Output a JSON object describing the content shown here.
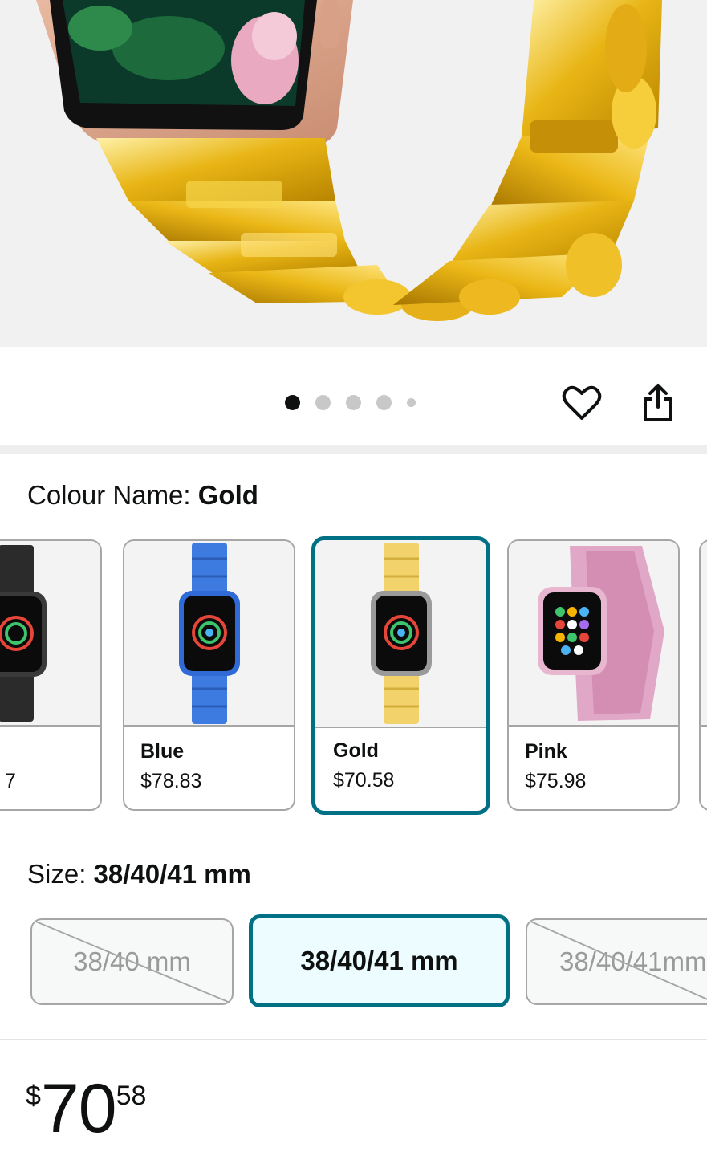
{
  "gallery": {
    "image_alt": "Gold stainless steel watch band on rose gold watch",
    "dot_count": 5,
    "active_index": 0
  },
  "actions": {
    "favorite_icon": "heart-outline-icon",
    "share_icon": "share-icon"
  },
  "colour": {
    "label_prefix": "Colour Name: ",
    "selected_value": "Gold",
    "options": [
      {
        "name": "",
        "price": "7",
        "color": "#2b2b2b"
      },
      {
        "name": "Blue",
        "price": "$78.83",
        "color": "#3d7be0"
      },
      {
        "name": "Gold",
        "price": "$70.58",
        "color": "#f2d36b",
        "selected": true
      },
      {
        "name": "Pink",
        "price": "$75.98",
        "color": "#e0a7c6"
      }
    ]
  },
  "size": {
    "label_prefix": "Size: ",
    "selected_value": "38/40/41 mm",
    "options": [
      {
        "label": "38/40 mm",
        "available": false
      },
      {
        "label": "38/40/41 mm",
        "available": true,
        "selected": true
      },
      {
        "label": "38/40/41mm",
        "available": false
      }
    ]
  },
  "price": {
    "currency": "$",
    "whole": "70",
    "fraction": "58"
  },
  "theme": {
    "accent": "#007185",
    "selected_bg": "#edfdff",
    "band_gold": "#e7b418"
  }
}
